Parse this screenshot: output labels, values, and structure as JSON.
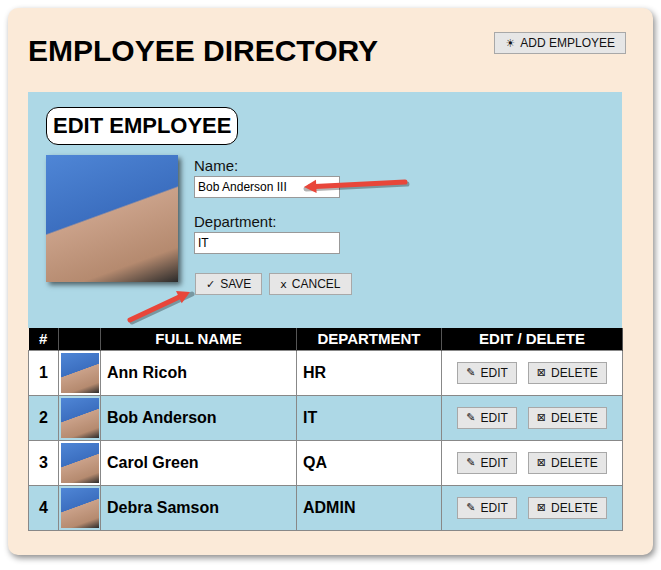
{
  "header": {
    "title": "EMPLOYEE DIRECTORY",
    "add_button": {
      "icon": "☀",
      "label": "ADD EMPLOYEE"
    }
  },
  "edit_form": {
    "title": "EDIT EMPLOYEE",
    "fields": [
      {
        "label": "Name:",
        "value": "Bob Anderson III"
      },
      {
        "label": "Department:",
        "value": "IT"
      }
    ],
    "buttons": [
      {
        "icon": "✓",
        "label": "SAVE"
      },
      {
        "icon": "x",
        "label": "CANCEL"
      }
    ]
  },
  "table": {
    "columns": [
      "#",
      "",
      "FULL NAME",
      "DEPARTMENT",
      "EDIT / DELETE"
    ],
    "rows": [
      {
        "number": "1",
        "name": "Ann Ricoh",
        "department": "HR"
      },
      {
        "number": "2",
        "name": "Bob Anderson",
        "department": "IT"
      },
      {
        "number": "3",
        "name": "Carol Green",
        "department": "QA"
      },
      {
        "number": "4",
        "name": "Debra Samson",
        "department": "ADMIN"
      }
    ],
    "actions": [
      {
        "icon": "✎",
        "label": "EDIT"
      },
      {
        "icon": "⊠",
        "label": "DELETE"
      }
    ]
  }
}
